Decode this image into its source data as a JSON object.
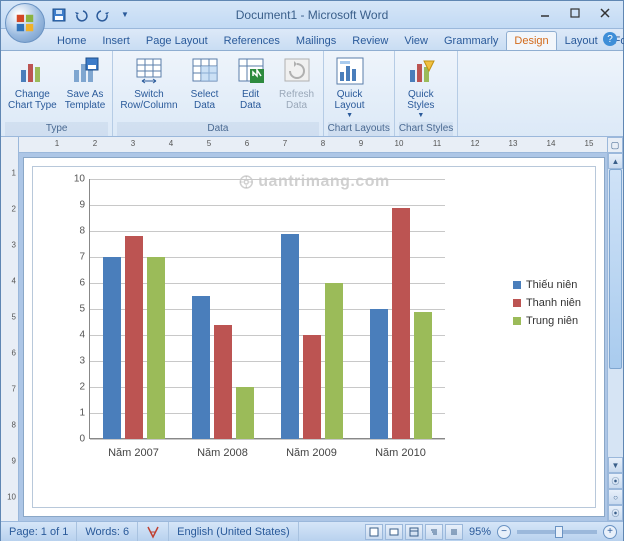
{
  "title": "Document1 - Microsoft Word",
  "tabs": [
    "Home",
    "Insert",
    "Page Layout",
    "References",
    "Mailings",
    "Review",
    "View",
    "Grammarly",
    "Design",
    "Layout",
    "Format"
  ],
  "active_tab": 8,
  "ribbon": {
    "groups": [
      {
        "label": "Type",
        "items": [
          {
            "name": "change-chart-type",
            "label": "Change\nChart Type"
          },
          {
            "name": "save-as-template",
            "label": "Save As\nTemplate"
          }
        ]
      },
      {
        "label": "Data",
        "items": [
          {
            "name": "switch-row-col",
            "label": "Switch\nRow/Column"
          },
          {
            "name": "select-data",
            "label": "Select\nData"
          },
          {
            "name": "edit-data",
            "label": "Edit\nData"
          },
          {
            "name": "refresh-data",
            "label": "Refresh\nData",
            "disabled": true
          }
        ]
      },
      {
        "label": "Chart Layouts",
        "items": [
          {
            "name": "quick-layout",
            "label": "Quick\nLayout",
            "dropdown": true
          }
        ]
      },
      {
        "label": "Chart Styles",
        "items": [
          {
            "name": "quick-styles",
            "label": "Quick\nStyles",
            "dropdown": true
          }
        ]
      }
    ]
  },
  "status": {
    "page": "Page: 1 of 1",
    "words": "Words: 6",
    "lang": "English (United States)",
    "zoom": "95%"
  },
  "watermark": "uantrimang.com",
  "chart_data": {
    "type": "bar",
    "categories": [
      "Năm 2007",
      "Năm 2008",
      "Năm 2009",
      "Năm 2010"
    ],
    "series": [
      {
        "name": "Thiếu niên",
        "color": "#4a7ebb",
        "values": [
          7.0,
          5.5,
          7.9,
          5.0
        ]
      },
      {
        "name": "Thanh niên",
        "color": "#bc5452",
        "values": [
          7.8,
          4.4,
          4.0,
          8.9
        ]
      },
      {
        "name": "Trung niên",
        "color": "#9bbb59",
        "values": [
          7.0,
          2.0,
          6.0,
          4.9
        ]
      }
    ],
    "ylim": [
      0,
      10
    ],
    "yticks": [
      0,
      1,
      2,
      3,
      4,
      5,
      6,
      7,
      8,
      9,
      10
    ]
  }
}
